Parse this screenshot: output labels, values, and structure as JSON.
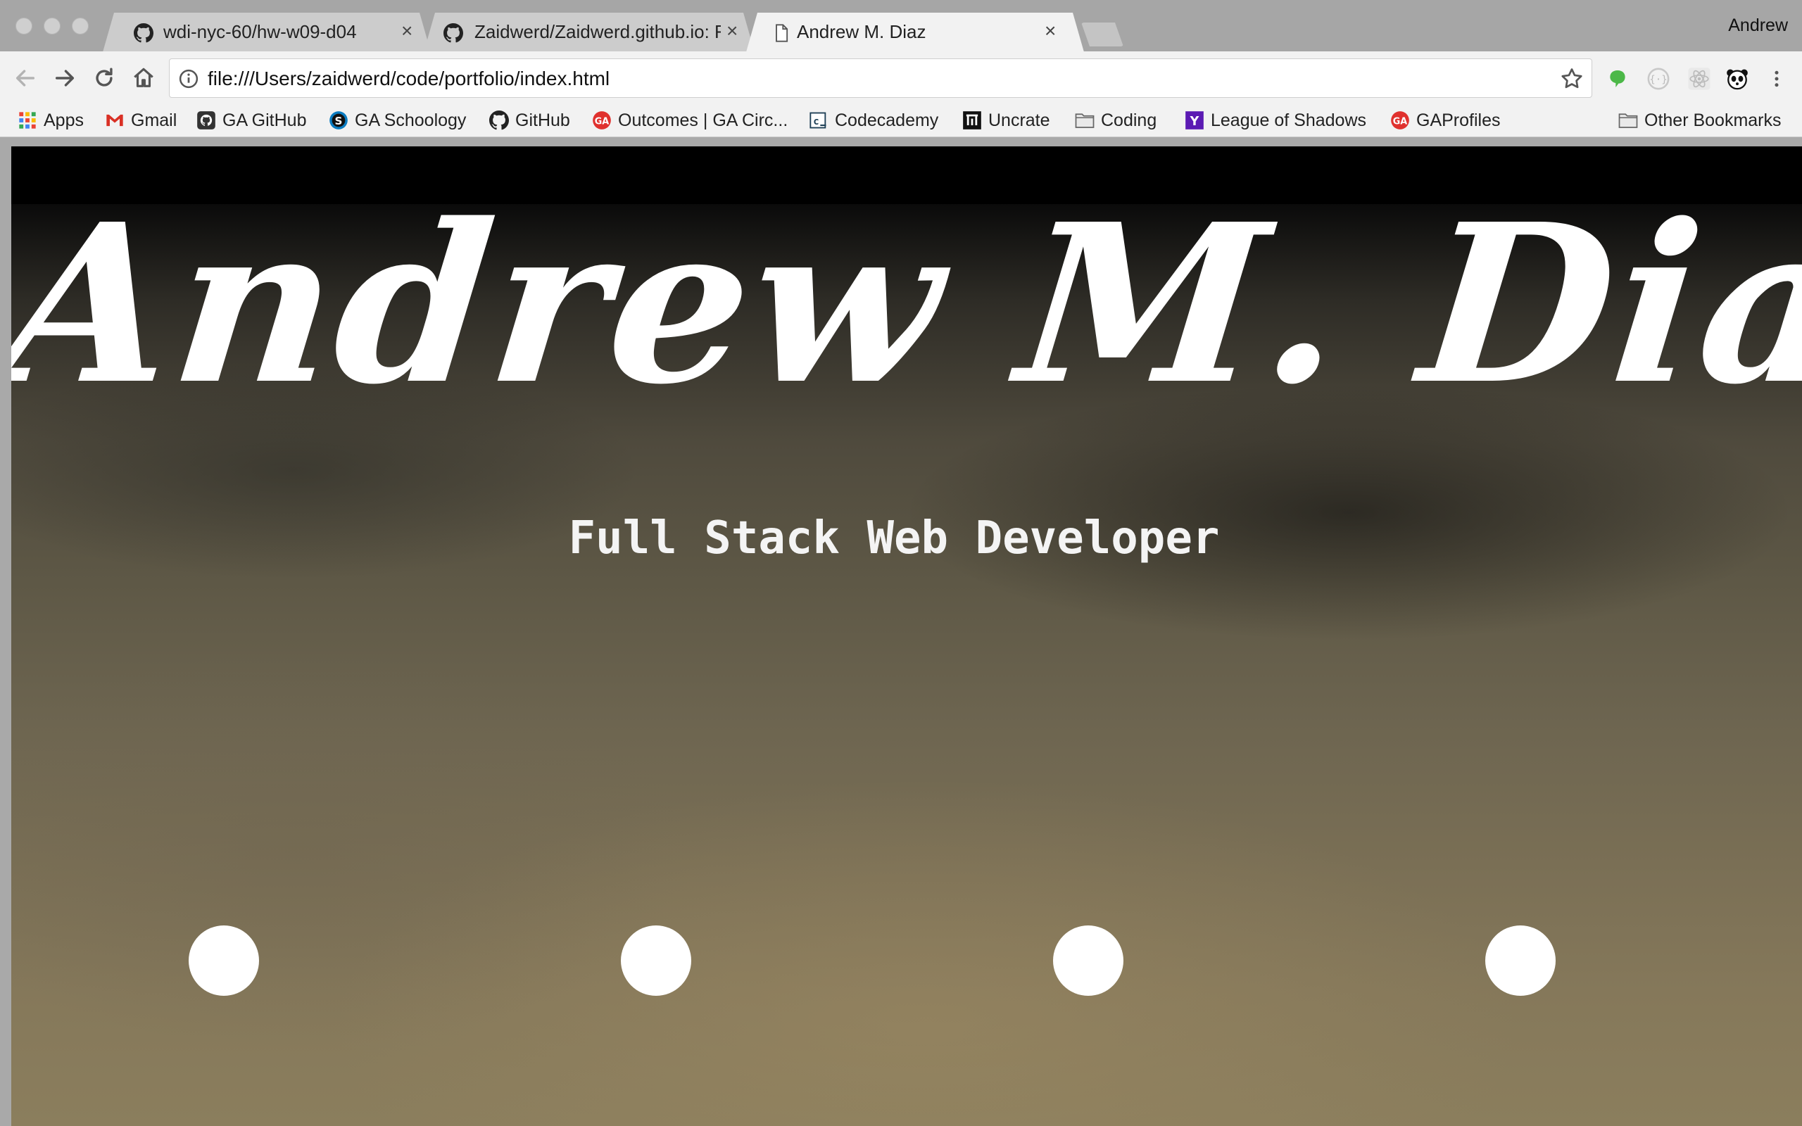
{
  "browser": {
    "profile_name": "Andrew",
    "tabs": [
      {
        "title": "wdi-nyc-60/hw-w09-d04",
        "icon": "github-icon",
        "active": false
      },
      {
        "title": "Zaidwerd/Zaidwerd.github.io: F",
        "icon": "github-icon",
        "active": false
      },
      {
        "title": "Andrew M. Diaz",
        "icon": "page-icon",
        "active": true
      }
    ],
    "tab_close_glyph": "×",
    "address_bar": {
      "url": "file:///Users/zaidwerd/code/portfolio/index.html"
    },
    "bookmarks": [
      {
        "label": "Apps",
        "icon": "apps-grid-icon"
      },
      {
        "label": "Gmail",
        "icon": "gmail-icon"
      },
      {
        "label": "GA GitHub",
        "icon": "github-icon"
      },
      {
        "label": "GA Schoology",
        "icon": "schoology-icon"
      },
      {
        "label": "GitHub",
        "icon": "github-icon"
      },
      {
        "label": "Outcomes | GA Circ...",
        "icon": "ga-icon"
      },
      {
        "label": "Codecademy",
        "icon": "codecademy-icon"
      },
      {
        "label": "Uncrate",
        "icon": "uncrate-icon"
      },
      {
        "label": "Coding",
        "icon": "folder-icon"
      },
      {
        "label": "League of Shadows",
        "icon": "yahoo-icon"
      },
      {
        "label": "GAProfiles",
        "icon": "ga-icon"
      }
    ],
    "other_bookmarks": {
      "label": "Other Bookmarks",
      "icon": "folder-icon"
    }
  },
  "page": {
    "hero_title": "Andrew M. Diaz",
    "hero_subtitle": "Full Stack Web Developer",
    "nav_dots_count": 4
  },
  "colors": {
    "tab_strip": "#a6a6a6",
    "toolbar": "#f2f2f2",
    "hero_text": "#ffffff",
    "ga_red": "#e0312e",
    "yahoo_purple": "#5b1ab3"
  }
}
